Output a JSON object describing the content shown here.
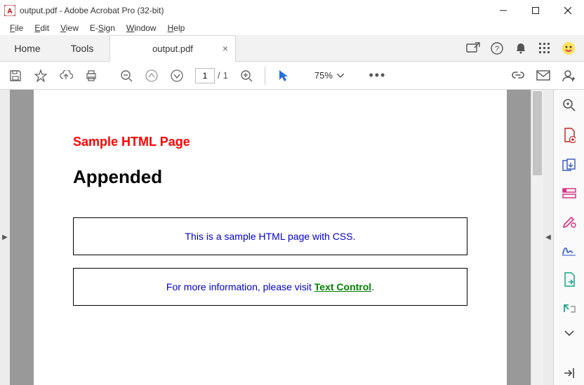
{
  "window": {
    "title": "output.pdf - Adobe Acrobat Pro (32-bit)"
  },
  "menu": {
    "file": "File",
    "edit": "Edit",
    "view": "View",
    "esign": "E-Sign",
    "window": "Window",
    "help": "Help"
  },
  "tabs": {
    "home": "Home",
    "tools": "Tools",
    "doc": "output.pdf"
  },
  "toolbar": {
    "page_current": "1",
    "page_sep": "/",
    "page_total": "1",
    "zoom": "75%"
  },
  "document": {
    "heading_red": "Sample HTML Page",
    "heading_black": "Appended",
    "line1": "This is a sample HTML page with CSS.",
    "line2_prefix": "For more information, please visit ",
    "line2_link": "Text Control",
    "line2_suffix": "."
  }
}
